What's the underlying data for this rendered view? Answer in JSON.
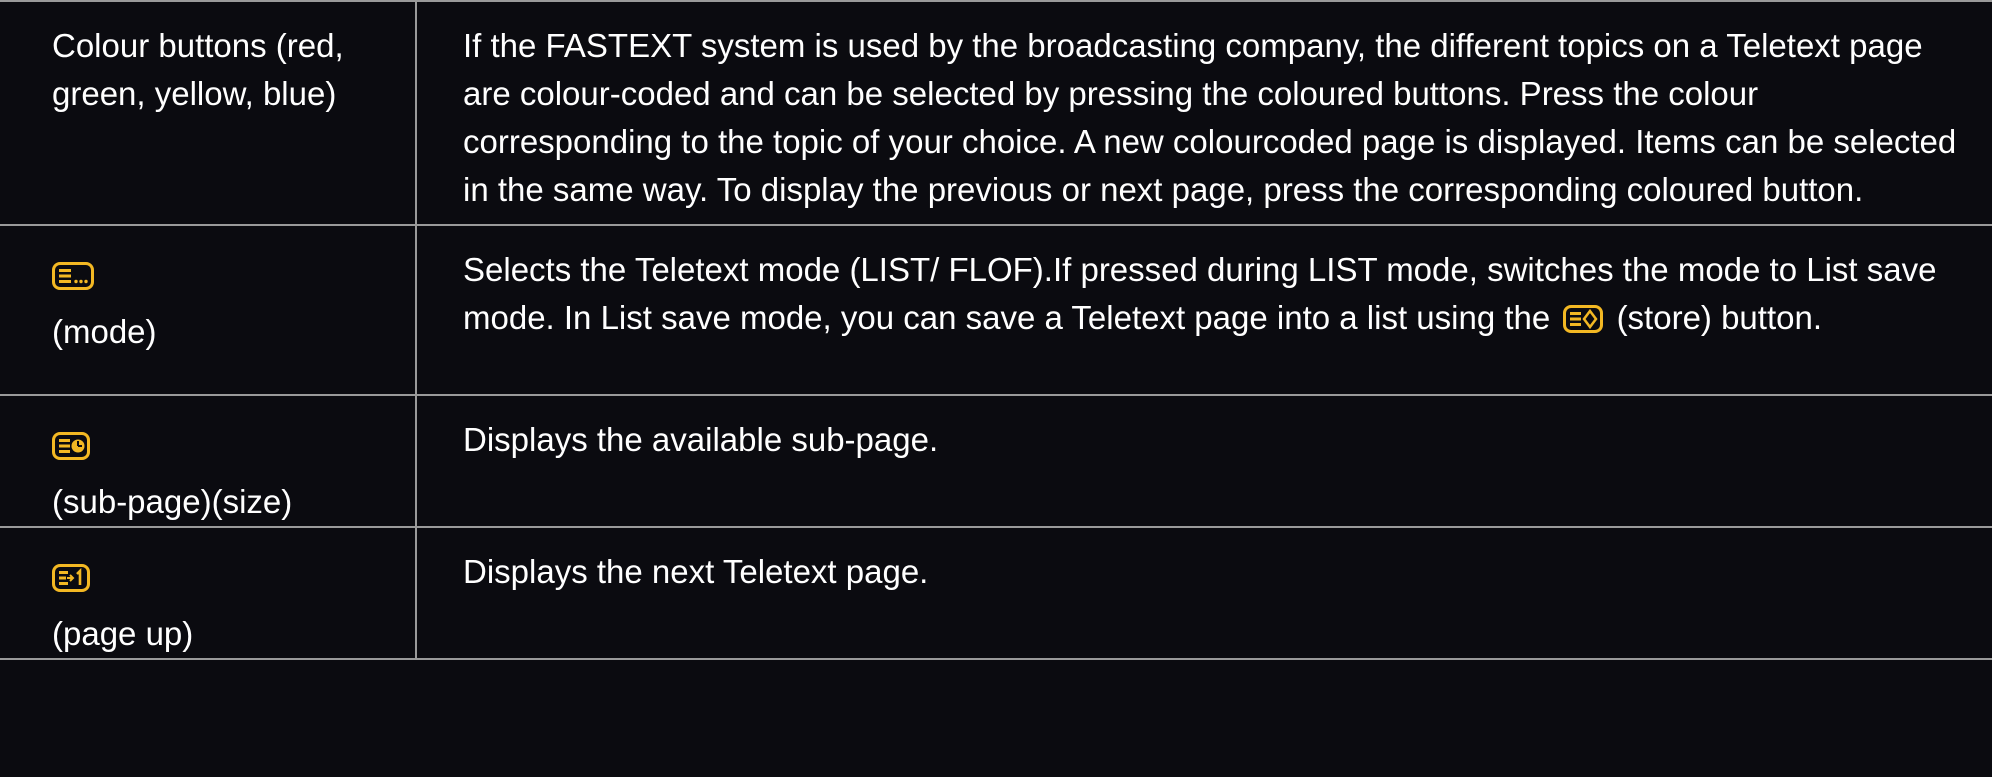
{
  "rows": [
    {
      "key_text": "Colour buttons (red, green, yellow, blue)",
      "description": "If the FASTEXT system is used by the broadcasting company, the different topics on a Teletext page are colour-coded and can be selected by pressing the coloured buttons. Press the colour corresponding to the topic of your choice. A new colourcoded page is displayed. Items can be selected in the same way. To display the previous or next page, press the corresponding coloured button."
    },
    {
      "key_icon": "teletext-mode-icon",
      "key_label": "(mode)",
      "description_before": "Selects the Teletext mode (LIST/ FLOF).If pressed during LIST mode, switches the mode to List save mode. In List save mode, you can save a Teletext page into a list using the",
      "inline_icon": "teletext-store-icon",
      "description_after": "(store) button."
    },
    {
      "key_icon": "teletext-subpage-icon",
      "key_label": "(sub-page)(size)",
      "description": "Displays the available sub-page."
    },
    {
      "key_icon": "teletext-page-up-icon",
      "key_label": "(page up)",
      "description": "Displays the next Teletext page."
    }
  ],
  "colors": {
    "background": "#0b0b10",
    "text": "#ffffff",
    "icon_accent": "#f3b823",
    "rule": "#9a9a9a"
  }
}
